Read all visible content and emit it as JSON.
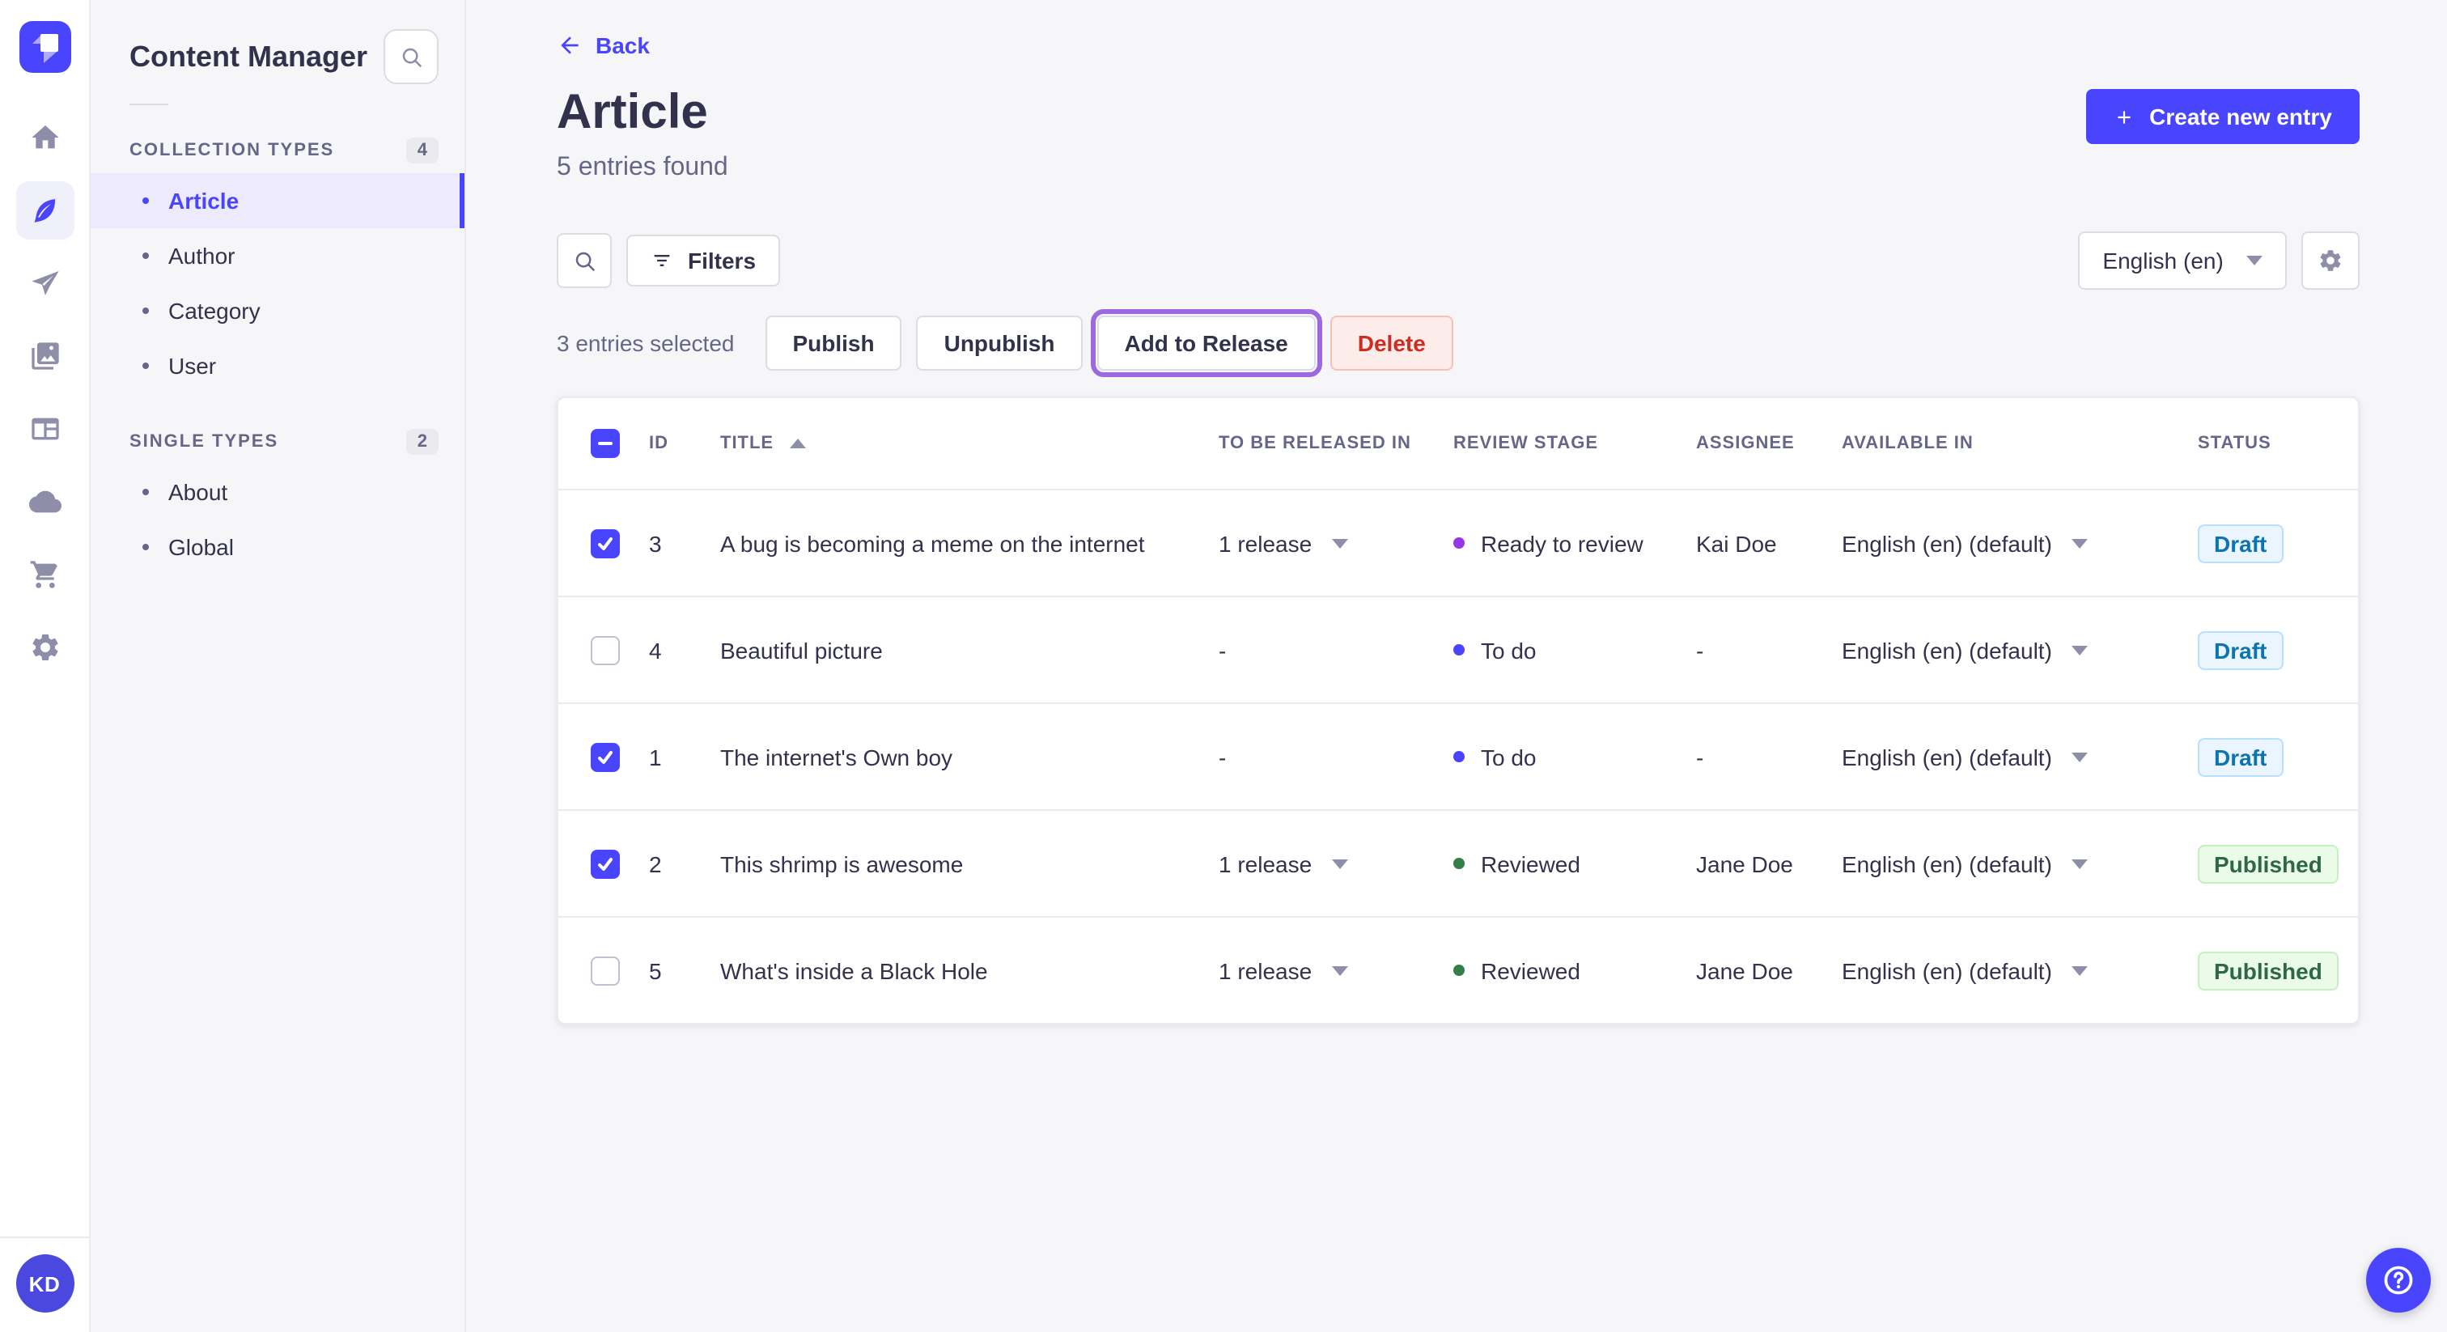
{
  "nav": {
    "logo_icon": "strapi-logo",
    "rail_icons": [
      "home-icon",
      "content-manager-feather-icon",
      "paper-plane-icon",
      "media-library-images-icon",
      "content-type-builder-layout-icon",
      "cloud-icon",
      "marketplace-cart-icon",
      "settings-gear-icon"
    ],
    "active_rail_icon": "content-manager-feather-icon",
    "avatar_initials": "KD"
  },
  "subnav": {
    "title": "Content Manager",
    "search_icon": "search-icon",
    "sections": [
      {
        "label": "COLLECTION TYPES",
        "count": "4",
        "items": [
          {
            "label": "Article",
            "active": true
          },
          {
            "label": "Author",
            "active": false
          },
          {
            "label": "Category",
            "active": false
          },
          {
            "label": "User",
            "active": false
          }
        ]
      },
      {
        "label": "SINGLE TYPES",
        "count": "2",
        "items": [
          {
            "label": "About",
            "active": false
          },
          {
            "label": "Global",
            "active": false
          }
        ]
      }
    ]
  },
  "header": {
    "back_label": "Back",
    "title": "Article",
    "subtitle": "5 entries found",
    "create_button_label": "Create new entry"
  },
  "toolbar": {
    "filters_label": "Filters",
    "locale_value": "English (en)"
  },
  "selection": {
    "text": "3 entries selected",
    "publish_label": "Publish",
    "unpublish_label": "Unpublish",
    "add_to_release_label": "Add to Release",
    "delete_label": "Delete"
  },
  "table": {
    "columns": [
      "ID",
      "TITLE",
      "TO BE RELEASED IN",
      "REVIEW STAGE",
      "ASSIGNEE",
      "AVAILABLE IN",
      "STATUS"
    ],
    "sorted_column": "TITLE",
    "sort_direction": "ascending",
    "header_checkbox_state": "indeterminate",
    "rows": [
      {
        "checked": true,
        "id": "3",
        "title": "A bug is becoming a meme on the internet",
        "release": "1 release",
        "review": {
          "label": "Ready to review",
          "dot_color": "#9736e8"
        },
        "assignee": "Kai Doe",
        "available": "English (en) (default)",
        "status": "Draft",
        "status_variant": "draft"
      },
      {
        "checked": false,
        "id": "4",
        "title": "Beautiful picture",
        "release": "-",
        "review": {
          "label": "To do",
          "dot_color": "#4945ff"
        },
        "assignee": "-",
        "available": "English (en) (default)",
        "status": "Draft",
        "status_variant": "draft"
      },
      {
        "checked": true,
        "id": "1",
        "title": "The internet's Own boy",
        "release": "-",
        "review": {
          "label": "To do",
          "dot_color": "#4945ff"
        },
        "assignee": "-",
        "available": "English (en) (default)",
        "status": "Draft",
        "status_variant": "draft"
      },
      {
        "checked": true,
        "id": "2",
        "title": "This shrimp is awesome",
        "release": "1 release",
        "review": {
          "label": "Reviewed",
          "dot_color": "#328048"
        },
        "assignee": "Jane Doe",
        "available": "English (en) (default)",
        "status": "Published",
        "status_variant": "published"
      },
      {
        "checked": false,
        "id": "5",
        "title": "What's inside a Black Hole",
        "release": "1 release",
        "review": {
          "label": "Reviewed",
          "dot_color": "#328048"
        },
        "assignee": "Jane Doe",
        "available": "English (en) (default)",
        "status": "Published",
        "status_variant": "published"
      }
    ]
  },
  "fab": {
    "help_icon": "help-question-icon"
  },
  "colors": {
    "primary": "#4945ff",
    "focus_ring_purple": "#9c6ade",
    "danger_text": "#d02b20",
    "danger_bg": "#fcecea",
    "draft_text": "#0c75af",
    "draft_bg": "#eaf5ff",
    "published_text": "#2f6846",
    "published_bg": "#eafbe7",
    "page_bg": "#f6f6f9"
  }
}
